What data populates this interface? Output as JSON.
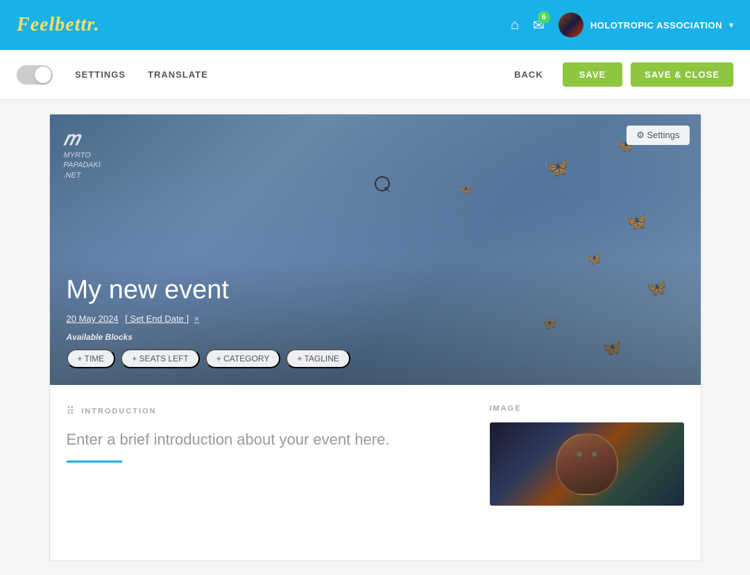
{
  "brand": {
    "logo_text": "Feelbettr.",
    "logo_part1": "Feel",
    "logo_part2": "bettr."
  },
  "nav": {
    "notification_count": "6",
    "org_name": "HOLOTROPIC ASSOCIATION",
    "chevron": "▾"
  },
  "toolbar": {
    "settings_label": "SETTINGS",
    "translate_label": "TRANSLATE",
    "back_label": "BACK",
    "save_label": "SAVE",
    "save_close_label": "SAVE & CLOSE"
  },
  "hero": {
    "settings_btn": "⚙ Settings",
    "logo_icon": "m",
    "logo_line1": "MYRTO",
    "logo_line2": "PAPADAKI",
    "logo_line3": ".NET",
    "event_title": "My new event",
    "event_date": "20 May 2024",
    "set_end_date": "[ Set End Date ]",
    "date_remove": "×",
    "available_blocks": "Available Blocks",
    "tags": [
      "+ TIME",
      "+ SEATS LEFT",
      "+ CATEGORY",
      "+ TAGLINE"
    ]
  },
  "body": {
    "intro_section_label": "INTRODUCTION",
    "intro_placeholder": "Enter a brief introduction about your event here.",
    "image_section_label": "IMAGE"
  }
}
